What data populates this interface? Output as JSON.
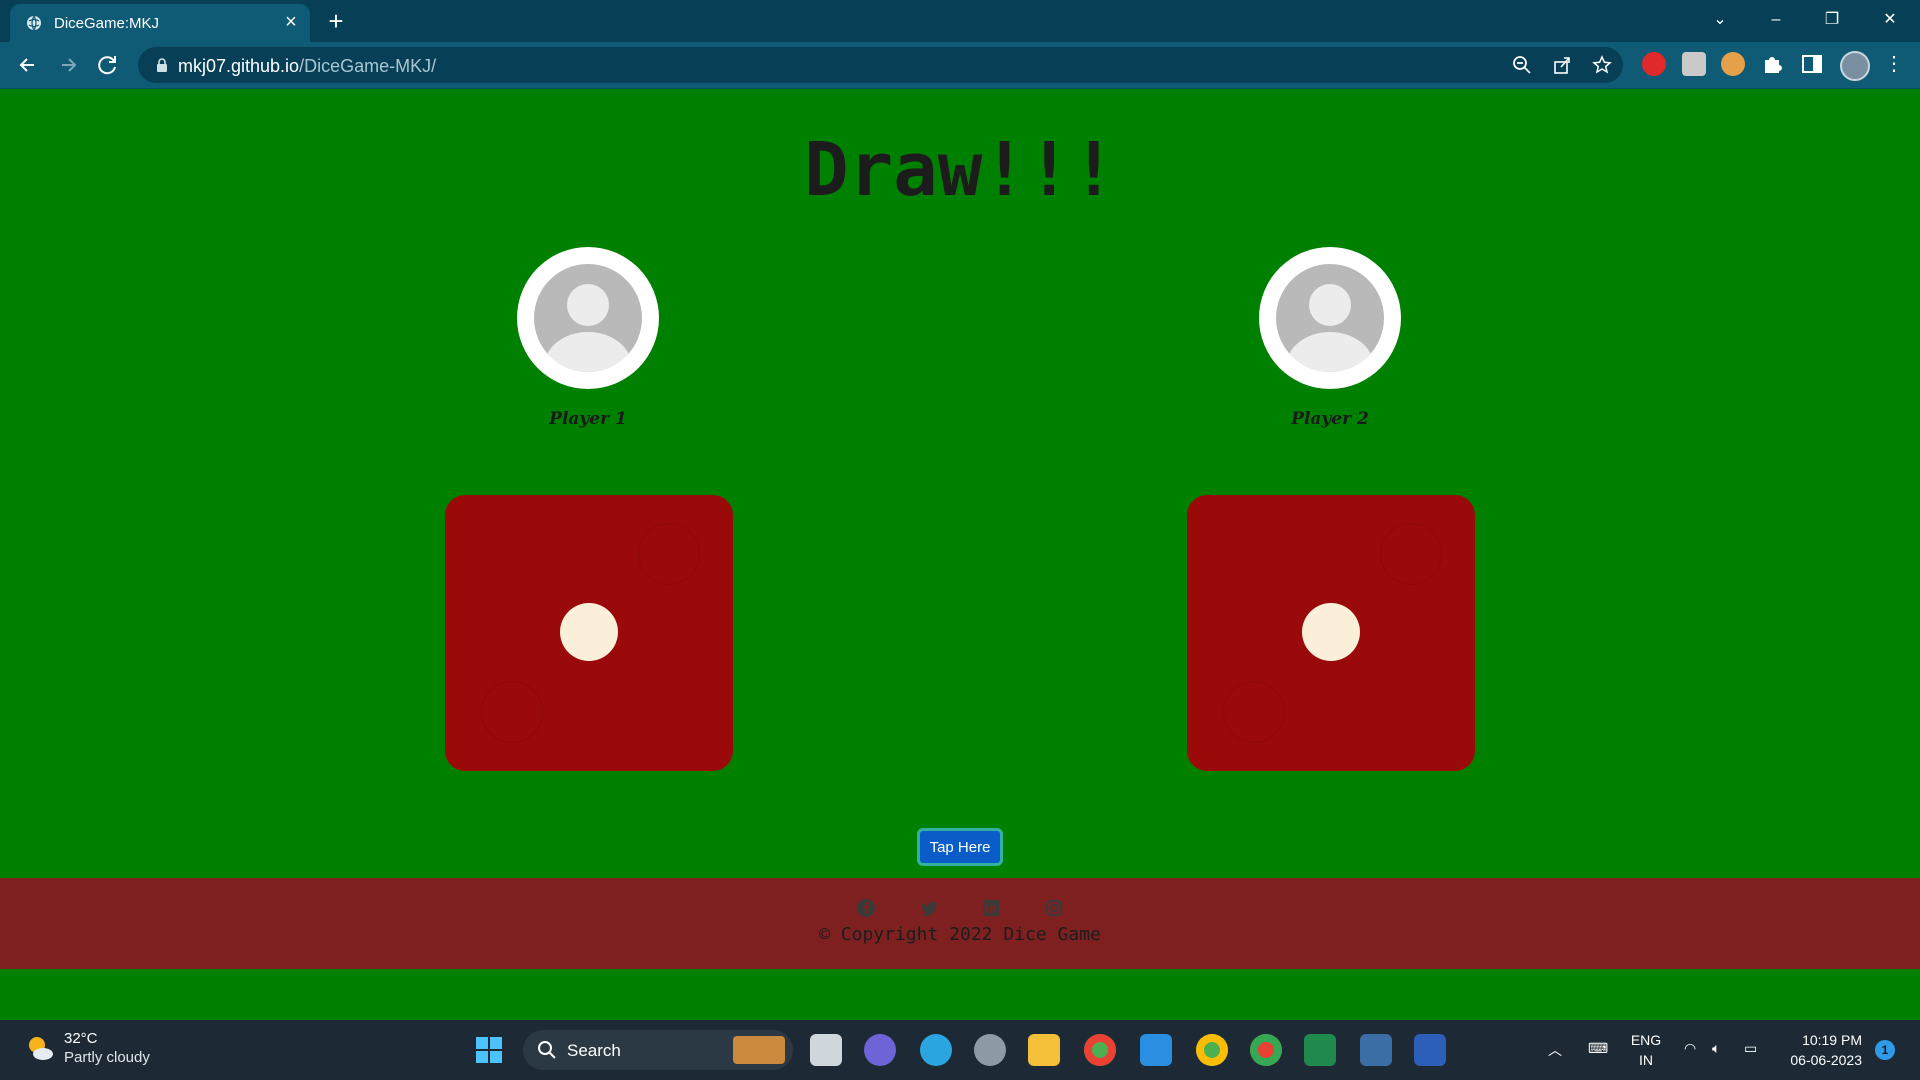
{
  "browser": {
    "tab_title": "DiceGame:MKJ",
    "url_host": "mkj07.github.io",
    "url_path": "/DiceGame-MKJ/",
    "accent": "#0f5a74"
  },
  "page": {
    "headline": "Draw!!!",
    "background": "#008000",
    "players": [
      {
        "name": "Player 1",
        "die_value": 1
      },
      {
        "name": "Player 2",
        "die_value": 1
      }
    ],
    "die_color": "#9b0a0a",
    "tap_button_label": "Tap Here",
    "footer": {
      "social_icons": [
        "facebook-icon",
        "twitter-icon",
        "linkedin-icon",
        "instagram-icon"
      ],
      "copyright": "© Copyright 2022 Dice Game",
      "color": "#7f2020"
    }
  },
  "taskbar": {
    "weather_temp": "32°C",
    "weather_desc": "Partly cloudy",
    "search_placeholder": "Search",
    "lang_line1": "ENG",
    "lang_line2": "IN",
    "time": "10:19 PM",
    "date": "06-06-2023",
    "notifications": "1"
  }
}
